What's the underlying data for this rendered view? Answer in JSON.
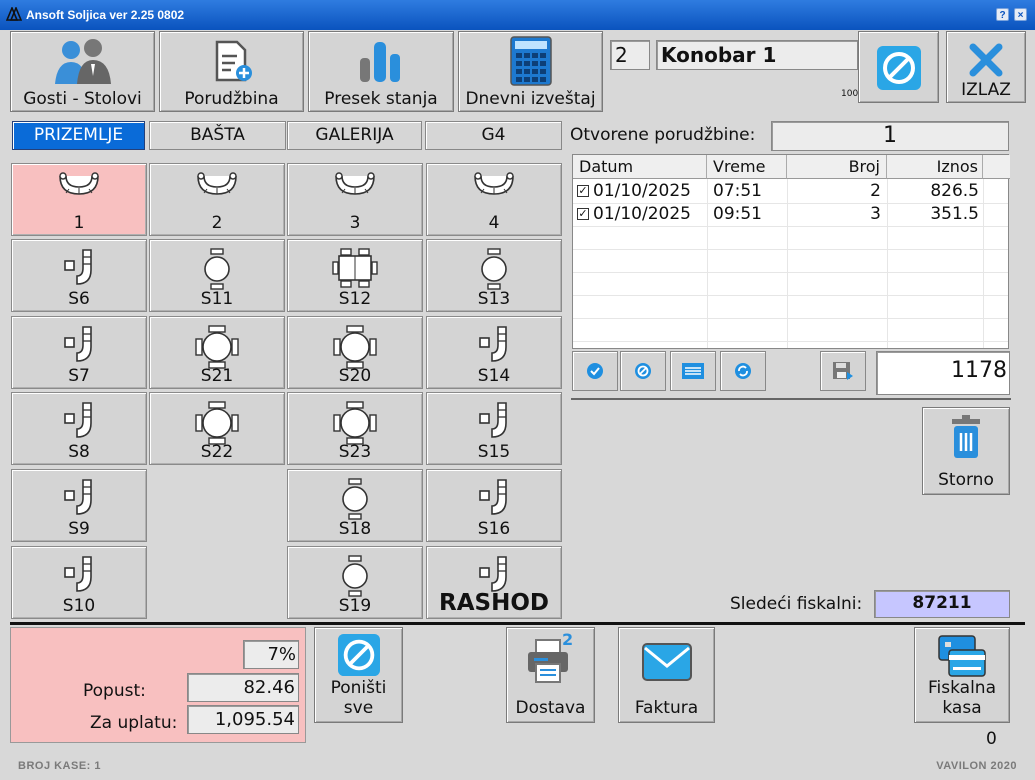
{
  "window": {
    "title": "Ansoft Soljica ver 2.25 0802"
  },
  "toolbar": {
    "gosti_stolovi": "Gosti - Stolovi",
    "porudzbina": "Porudžbina",
    "presek_stanja": "Presek stanja",
    "dnevni_izvestaj": "Dnevni izveštaj",
    "izlaz": "IZLAZ"
  },
  "waiter": {
    "id": "2",
    "name": "Konobar 1",
    "small_note": "100"
  },
  "tabs": [
    "PRIZEMLJE",
    "BAŠTA",
    "GALERIJA",
    "G4"
  ],
  "tables": [
    {
      "label": "1",
      "icon": "booth-icon",
      "selected": true
    },
    {
      "label": "2",
      "icon": "booth-icon"
    },
    {
      "label": "3",
      "icon": "booth-icon"
    },
    {
      "label": "4",
      "icon": "booth-icon"
    },
    {
      "label": "S6",
      "icon": "bar-seat-icon"
    },
    {
      "label": "S11",
      "icon": "two-chair-table-icon"
    },
    {
      "label": "S12",
      "icon": "six-chair-table-icon"
    },
    {
      "label": "S13",
      "icon": "two-chair-table-icon"
    },
    {
      "label": "S7",
      "icon": "bar-seat-icon"
    },
    {
      "label": "S21",
      "icon": "four-chair-table-icon"
    },
    {
      "label": "S20",
      "icon": "four-chair-table-icon"
    },
    {
      "label": "S14",
      "icon": "bar-seat-icon"
    },
    {
      "label": "S8",
      "icon": "bar-seat-icon"
    },
    {
      "label": "S22",
      "icon": "four-chair-table-icon"
    },
    {
      "label": "S23",
      "icon": "four-chair-table-icon"
    },
    {
      "label": "S15",
      "icon": "bar-seat-icon"
    },
    {
      "label": "S9",
      "icon": "bar-seat-icon"
    },
    {
      "label": "S18",
      "icon": "two-chair-table-icon"
    },
    {
      "label": "S16",
      "icon": "bar-seat-icon"
    },
    {
      "label": "S10",
      "icon": "bar-seat-icon"
    },
    {
      "label": "S19",
      "icon": "two-chair-table-icon"
    },
    {
      "label": "RASHOD",
      "icon": "bar-seat-icon"
    }
  ],
  "orders": {
    "label": "Otvorene porudžbine:",
    "count": "1",
    "columns": [
      "Datum",
      "Vreme",
      "Broj",
      "Iznos"
    ],
    "rows": [
      {
        "datum": "01/10/2025",
        "vreme": "07:51",
        "broj": "2",
        "iznos": "826.5"
      },
      {
        "datum": "01/10/2025",
        "vreme": "09:51",
        "broj": "3",
        "iznos": "351.5"
      }
    ],
    "total": "1178"
  },
  "storno": "Storno",
  "fiscal": {
    "label": "Sledeći fiskalni:",
    "value": "87211"
  },
  "summary": {
    "percent": "7%",
    "popust_label": "Popust:",
    "popust": "82.46",
    "za_uplatu_label": "Za uplatu:",
    "za_uplatu": "1,095.54"
  },
  "bottom": {
    "ponisti": [
      "Poništi",
      "sve"
    ],
    "dostava": "Dostava",
    "dostava_badge": "2",
    "faktura": "Faktura",
    "fiskalna": [
      "Fiskalna",
      "kasa"
    ],
    "counter": "0"
  },
  "footer": {
    "left": "BROJ KASE: 1",
    "right": "VAVILON 2020"
  }
}
